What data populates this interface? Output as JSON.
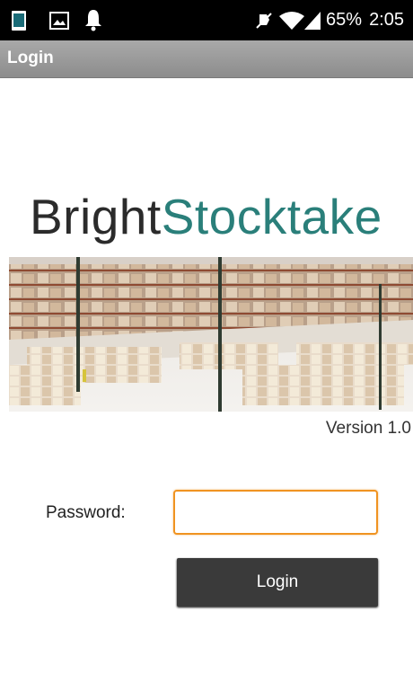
{
  "status_bar": {
    "battery": "65%",
    "time": "2:05",
    "icons": [
      "phone-icon",
      "image-icon",
      "notification-bell-icon",
      "mute-icon",
      "wifi-icon",
      "signal-icon"
    ]
  },
  "app_bar": {
    "title": "Login"
  },
  "logo": {
    "part1": "Bright",
    "part2": "Stocktake"
  },
  "banner": {
    "icon": "warehouse-image"
  },
  "version": "Version 1.0",
  "form": {
    "password_label": "Password:",
    "password_value": "",
    "login_button": "Login"
  },
  "colors": {
    "logo_dark": "#2b2b2b",
    "logo_accent": "#2a7f7a",
    "input_focus": "#f09321",
    "button_bg": "#3a3a3a",
    "titlebar": "#9a9a9a"
  }
}
